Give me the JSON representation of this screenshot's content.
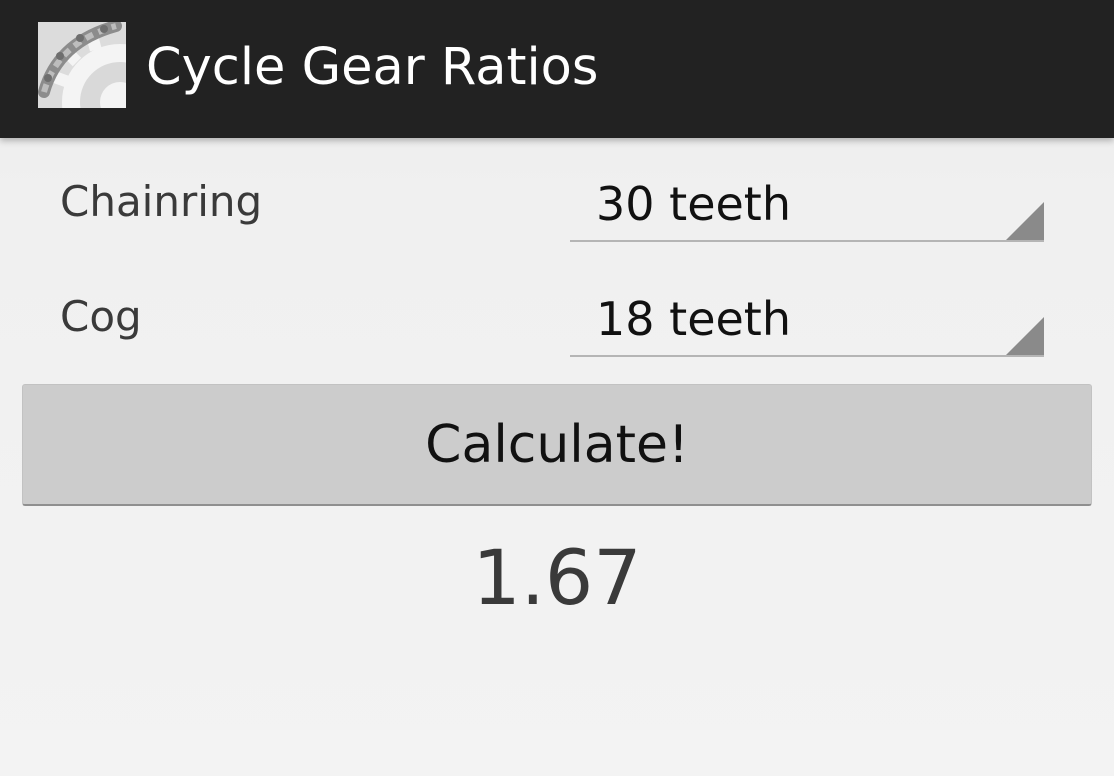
{
  "action_bar": {
    "title": "Cycle Gear Ratios",
    "icon": "bike-chain-gear-icon",
    "background_color": "#222222"
  },
  "form": {
    "chainring": {
      "label": "Chainring",
      "selected": "30 teeth"
    },
    "cog": {
      "label": "Cog",
      "selected": "18 teeth"
    }
  },
  "calculate_button": {
    "label": "Calculate!"
  },
  "result": {
    "value": "1.67"
  }
}
